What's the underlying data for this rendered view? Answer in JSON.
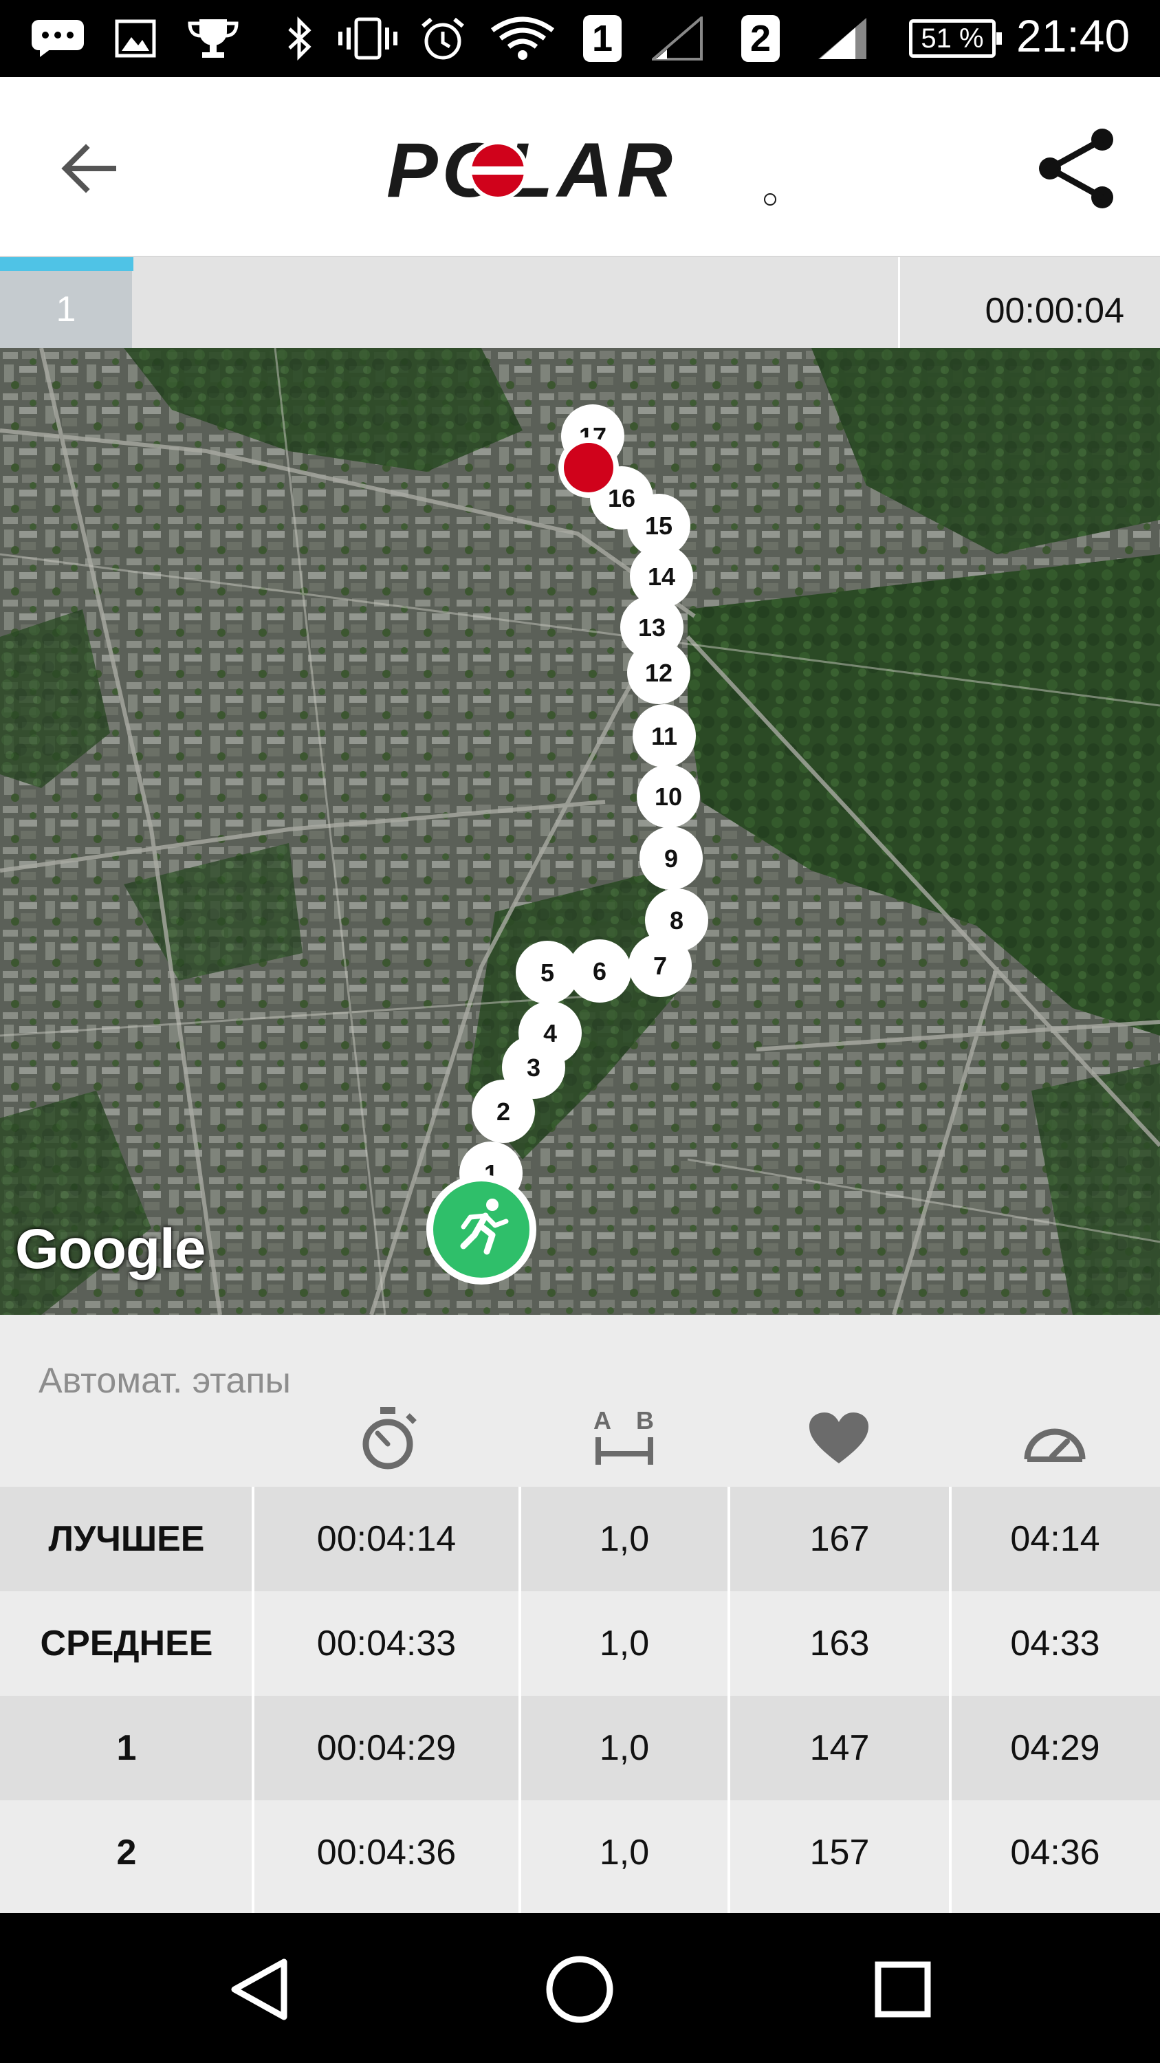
{
  "status_bar": {
    "icons": [
      "message-icon",
      "image-icon",
      "trophy-icon",
      "bluetooth-icon",
      "vibrate-icon",
      "alarm-icon",
      "wifi-icon",
      "signal-icon",
      "signal-icon"
    ],
    "sim1": "1",
    "sim2": "2",
    "battery": "51 %",
    "time": "21:40"
  },
  "app_bar": {
    "logo_text": "POLAR",
    "back_icon": "arrow-left-icon",
    "share_icon": "share-icon"
  },
  "lap_bar": {
    "lap_number": "1",
    "lap_time": "00:00:04",
    "progress": 0.115
  },
  "map": {
    "attribution": "Google",
    "start_icon": "running-person-icon",
    "markers": [
      "1",
      "2",
      "3",
      "4",
      "5",
      "6",
      "7",
      "8",
      "9",
      "10",
      "11",
      "12",
      "13",
      "14",
      "15",
      "16",
      "17"
    ]
  },
  "colors": {
    "accent": "#4fc3e6",
    "start_marker": "#2fbf6a",
    "end_marker": "#d0021b",
    "logo_red": "#d0021b"
  },
  "laps": {
    "title": "Автомат. этапы",
    "column_icons": [
      "stopwatch-icon",
      "distance-icon",
      "heart-icon",
      "speedometer-icon"
    ],
    "distance_icon_letters": [
      "A",
      "B"
    ],
    "rows": [
      {
        "label": "ЛУЧШЕЕ",
        "time": "00:04:14",
        "distance": "1,0",
        "hr": "167",
        "pace": "04:14"
      },
      {
        "label": "СРЕДНЕЕ",
        "time": "00:04:33",
        "distance": "1,0",
        "hr": "163",
        "pace": "04:33"
      },
      {
        "label": "1",
        "time": "00:04:29",
        "distance": "1,0",
        "hr": "147",
        "pace": "04:29"
      },
      {
        "label": "2",
        "time": "00:04:36",
        "distance": "1,0",
        "hr": "157",
        "pace": "04:36"
      }
    ]
  },
  "nav_bar": {
    "buttons": [
      "back-triangle-icon",
      "home-circle-icon",
      "recents-square-icon"
    ]
  }
}
